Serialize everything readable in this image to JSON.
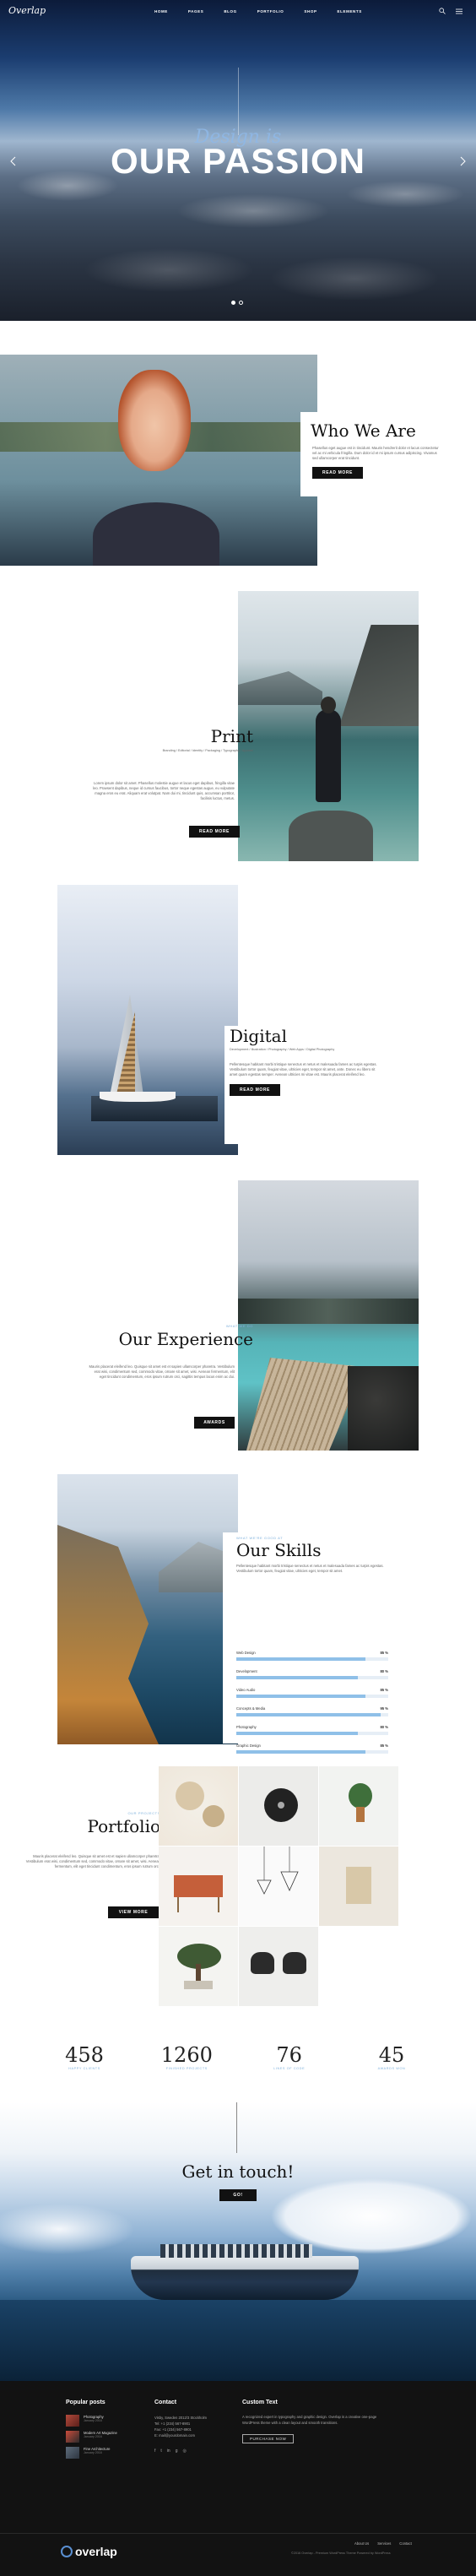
{
  "header": {
    "logo": "Overlap",
    "nav": [
      "HOME",
      "PAGES",
      "BLOG",
      "PORTFOLIO",
      "SHOP",
      "ELEMENTS"
    ]
  },
  "hero": {
    "script_title": "Design is",
    "main_title": "OUR PASSION",
    "slide_count": 2,
    "active_slide": 1
  },
  "who": {
    "title": "Who We Are",
    "text": "Phasellus eget augue est in tincidunt. Mauris hendrerit dolor et lacus consectetur vel ac mi vehicula fringilla. Dum dolor id et mi ipsum cursus adipiscing. Vivamus sed ullamcorper erat tincidunt.",
    "button": "READ MORE"
  },
  "print": {
    "title": "Print",
    "subtitle": "Branding / Editorial / Identity / Packaging / Typography / Apparel",
    "text": "Lorem ipsum dolor sit amet. Phasellus molestie augue et lacus eget dapibus, fringilla vitae leo. Praesent dapibus, neque id cursus faucibus, tortor neque egestas augue, eu vulputate magna eros eu erat. Aliquam erat volutpat. Nam dui mi, tincidunt quis, accumsan porttitor, facilisis luctus, metus.",
    "button": "READ MORE"
  },
  "digital": {
    "title": "Digital",
    "subtitle": "Development / Illustration / Photography / Web Apps / Digital Photography",
    "text": "Pellentesque habitant morbi tristique senectus et netus et malesuada fames ac turpis egestas. Vestibulum tortor quam, feugiat vitae, ultricies eget, tempor sit amet, ante. Donec eu libero sit amet quam egestas semper. Aenean ultricies mi vitae est. Mauris placerat eleifend leo.",
    "button": "READ MORE"
  },
  "experience": {
    "kicker": "WHAT WE DO",
    "title": "Our Experience",
    "text": "Mauris placerat eleifend leo. Quisque sit amet est et sapien ullamcorper pharetra. Vestibulum erat wisi, condimentum sed, commodo vitae, ornare sit amet, wisi. Aenean fermentum, elit eget tincidunt condimentum, eros ipsum rutrum orci, sagittis tempus lacus enim ac dui.",
    "button": "AWARDS"
  },
  "skills": {
    "kicker": "WHAT WE'RE GOOD AT",
    "title": "Our Skills",
    "text": "Pellentesque habitant morbi tristique senectus et netus et malesuada fames ac turpis egestas. Vestibulum tortor quam, feugiat vitae, ultricies eget, tempor sit amet.",
    "items": [
      {
        "label": "Web Design",
        "value": "85 %",
        "level": 0.85
      },
      {
        "label": "Development",
        "value": "80 %",
        "level": 0.8
      },
      {
        "label": "Video Audio",
        "value": "85 %",
        "level": 0.85
      },
      {
        "label": "Concepts & Media",
        "value": "95 %",
        "level": 0.95
      },
      {
        "label": "Photography",
        "value": "80 %",
        "level": 0.8
      },
      {
        "label": "Graphic Design",
        "value": "85 %",
        "level": 0.85
      }
    ]
  },
  "portfolio": {
    "kicker": "OUR PROJECTS",
    "title": "Portfolio",
    "text": "Mauris placerat eleifend leo. Quisque sit amet est et sapien ullamcorper pharetra. Vestibulum erat wisi, condimentum sed, commodo vitae, ornare sit amet, wisi. Aenean fermentum, elit eget tincidunt condimentum, eros ipsum rutrum orci.",
    "button": "VIEW MORE"
  },
  "stats": [
    {
      "number": "458",
      "label": "HAPPY CLIENTS"
    },
    {
      "number": "1260",
      "label": "FINISHED PROJECTS"
    },
    {
      "number": "76",
      "label": "LINES OF CODE"
    },
    {
      "number": "45",
      "label": "AWARDS WON"
    }
  ],
  "contact_cta": {
    "title": "Get in touch!",
    "button": "GO!"
  },
  "footer": {
    "popular_title": "Popular posts",
    "posts": [
      {
        "title": "Photography",
        "date": "January 2016"
      },
      {
        "title": "Modern Art Magazine",
        "date": "January 2016"
      },
      {
        "title": "Fine Architecture",
        "date": "January 2016"
      }
    ],
    "contact_title": "Contact",
    "contact_lines": [
      "Visby, Sweden 2012/3 Stockholm",
      "Tel: +1 (234) 567-8901",
      "Fax: +1 (234) 567-8901",
      "E: mail@yourdomain.com"
    ],
    "custom_title": "Custom Text",
    "custom_text": "A recognized expert in typography and graphic design. Overlap is a creative one-page WordPress theme with a clean layout and smooth transitions.",
    "custom_button": "PURCHASE NOW",
    "bottom_logo": "overlap",
    "bottom_links": [
      "About Us",
      "Services",
      "Contact"
    ],
    "copyright": "©2016 Overlap - Premium WordPress Theme Powered by WordPress"
  }
}
